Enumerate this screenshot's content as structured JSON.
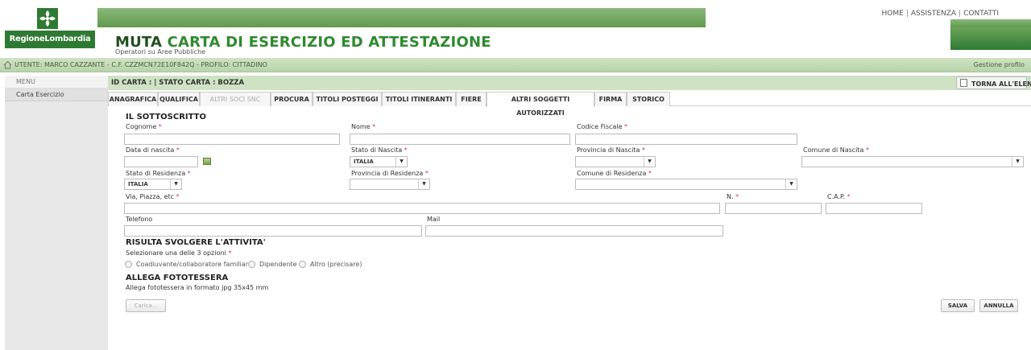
{
  "header": {
    "logo_text": "RegioneLombardia",
    "title_part1": "MUTA",
    "title_part2": "CARTA DI ESERCIZIO ED ATTESTAZIONE",
    "subtitle": "Operatori su Aree Pubbliche",
    "links": [
      "HOME",
      "ASSISTENZA",
      "CONTATTI"
    ],
    "link_separator": "|"
  },
  "user_bar": {
    "text": "UTENTE: MARCO CAZZANTE - C.F. CZZMCN72E10F842Q - PROFILO: CITTADINO",
    "profile_link": "Gestione profilo"
  },
  "sidebar": {
    "menu_label": "MENU",
    "items": [
      "Carta Esercizio"
    ]
  },
  "card_bar": {
    "info": "ID CARTA :  |   STATO CARTA : BOZZA",
    "back_button": "TORNA ALL'ELENCO"
  },
  "tabs": [
    {
      "label": "ANAGRAFICA",
      "state": "normal"
    },
    {
      "label": "QUALIFICA",
      "state": "normal"
    },
    {
      "label": "ALTRI SOCI SNC",
      "state": "disabled"
    },
    {
      "label": "PROCURA",
      "state": "normal"
    },
    {
      "label": "TITOLI POSTEGGI",
      "state": "normal"
    },
    {
      "label": "TITOLI ITINERANTI",
      "state": "normal"
    },
    {
      "label": "FIERE",
      "state": "normal"
    },
    {
      "label": "ALTRI SOGGETTI AUTORIZZATI",
      "state": "active"
    },
    {
      "label": "FIRMA",
      "state": "normal"
    },
    {
      "label": "STORICO",
      "state": "normal"
    }
  ],
  "form": {
    "section1_title": "IL SOTTOSCRITTO",
    "required_mark": "*",
    "cognome": "Cognome",
    "nome": "Nome",
    "codice_fiscale": "Codice Fiscale",
    "data_nascita": "Data di nascita",
    "stato_nascita": "Stato di Nascita",
    "stato_nascita_value": "ITALIA",
    "provincia_nascita": "Provincia di Nascita",
    "comune_nascita": "Comune di Nascita",
    "stato_residenza": "Stato di Residenza",
    "stato_residenza_value": "ITALIA",
    "provincia_residenza": "Provincia di Residenza",
    "comune_residenza": "Comune di Residenza",
    "via": "Via, Piazza, etc",
    "numero": "N.",
    "cap": "C.A.P.",
    "telefono": "Telefono",
    "mail": "Mail",
    "section2_title": "RISULTA SVOLGERE L'ATTIVITA'",
    "section2_hint": "Selezionare una delle 3 opzioni",
    "options": [
      "Coadiuvante/collaboratore familiare",
      "Dipendente",
      "Altro (precisare)"
    ],
    "section3_title": "ALLEGA FOTOTESSERA",
    "section3_hint": "Allega fototessera in formato jpg 35x45 mm",
    "upload_button": "Carica...",
    "save_button": "SALVA",
    "cancel_button": "ANNULLA"
  },
  "colors": {
    "brand_green": "#2f7a33",
    "bar_green_light": "#cfe3c4",
    "required_red": "#d33333"
  }
}
